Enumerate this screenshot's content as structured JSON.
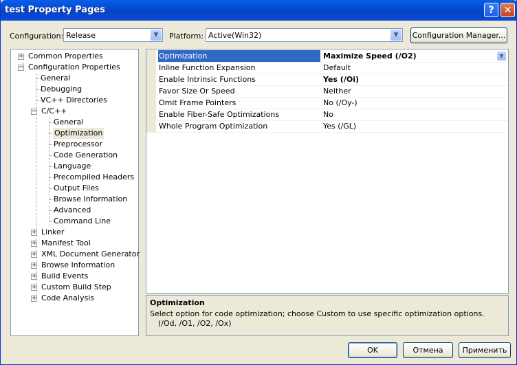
{
  "window": {
    "title": "test Property Pages"
  },
  "toolbar": {
    "configuration_label": "Configuration:",
    "configuration_value": "Release",
    "platform_label": "Platform:",
    "platform_value": "Active(Win32)",
    "config_manager_label": "Configuration Manager..."
  },
  "tree": {
    "common_properties": "Common Properties",
    "configuration_properties": "Configuration Properties",
    "general": "General",
    "debugging": "Debugging",
    "vcpp_directories": "VC++ Directories",
    "cpp": "C/C++",
    "cpp_children": [
      "General",
      "Optimization",
      "Preprocessor",
      "Code Generation",
      "Language",
      "Precompiled Headers",
      "Output Files",
      "Browse Information",
      "Advanced",
      "Command Line"
    ],
    "after_cpp": [
      "Linker",
      "Manifest Tool",
      "XML Document Generator",
      "Browse Information",
      "Build Events",
      "Custom Build Step",
      "Code Analysis"
    ]
  },
  "grid": {
    "rows": [
      {
        "name": "Optimization",
        "value": "Maximize Speed (/O2)",
        "bold": true,
        "selected": true
      },
      {
        "name": "Inline Function Expansion",
        "value": "Default",
        "bold": false
      },
      {
        "name": "Enable Intrinsic Functions",
        "value": "Yes (/Oi)",
        "bold": true
      },
      {
        "name": "Favor Size Or Speed",
        "value": "Neither",
        "bold": false
      },
      {
        "name": "Omit Frame Pointers",
        "value": "No (/Oy-)",
        "bold": false
      },
      {
        "name": "Enable Fiber-Safe Optimizations",
        "value": "No",
        "bold": false
      },
      {
        "name": "Whole Program Optimization",
        "value": "Yes (/GL)",
        "bold": false
      }
    ]
  },
  "description": {
    "title": "Optimization",
    "text": "Select option for code optimization; choose Custom to use specific optimization options.",
    "options": "(/Od, /O1, /O2, /Ox)"
  },
  "buttons": {
    "ok": "OK",
    "cancel": "Отмена",
    "apply": "Применить"
  },
  "icons": {
    "help": "help-icon",
    "close": "close-icon",
    "dropdown": "chevron-down-icon"
  }
}
